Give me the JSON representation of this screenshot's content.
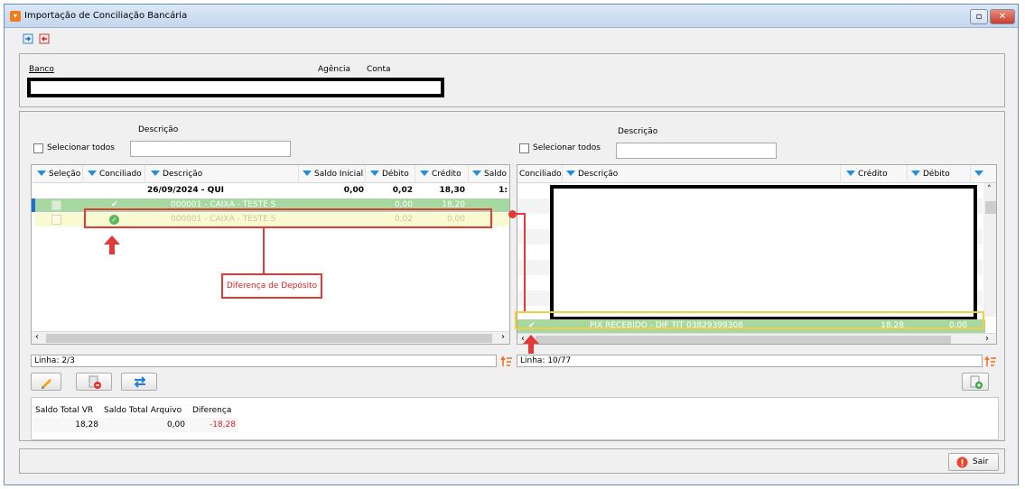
{
  "window": {
    "title": "Importação de Conciliação Bancária",
    "controls": [
      "restore",
      "close"
    ]
  },
  "toolbar": {
    "icons": [
      "import-blue-icon",
      "export-red-icon"
    ]
  },
  "bank": {
    "banco_label": "Banco",
    "agencia_label": "Agência",
    "conta_label": "Conta"
  },
  "left": {
    "descricao_label": "Descrição",
    "select_all_label": "Selecionar todos",
    "columns": [
      "Seleção",
      "Conciliado",
      "Descrição",
      "Saldo Inicial",
      "Débito",
      "Crédito",
      "Saldo F"
    ],
    "group_row": {
      "descricao": "26/09/2024 - QUI",
      "saldo_inicial": "0,00",
      "debito": "0,02",
      "credito": "18,30",
      "saldo_final": "1:"
    },
    "rows": [
      {
        "descricao": "000001 - CAIXA - TESTE S",
        "debito": "0,00",
        "credito": "18,20"
      },
      {
        "descricao": "000001 - CAIXA - TESTE S",
        "debito": "0,02",
        "credito": "0,00"
      }
    ],
    "status": "Linha: 2/3"
  },
  "right": {
    "descricao_label": "Descrição",
    "select_all_label": "Selecionar todos",
    "columns": [
      "Conciliado",
      "Descrição",
      "Crédito",
      "Débito"
    ],
    "selected_row": {
      "descricao": "PIX RECEBIDO - DIF TIT   03829399308",
      "credito": "18,28",
      "debito": "0,00"
    },
    "status": "Linha: 10/77"
  },
  "annotation": {
    "label": "Diferença de Depósito"
  },
  "totals": {
    "headers": [
      "Saldo Total VR",
      "Saldo Total Arquivo",
      "Diferença"
    ],
    "values": [
      "18,28",
      "0,00",
      "-18,28"
    ]
  },
  "footer": {
    "exit_label": "Sair"
  },
  "colors": {
    "accent": "#1f8fdd",
    "annotation": "#e53935",
    "selected_green": "#a8d8a2",
    "highlight_yellow": "#fafad2"
  }
}
